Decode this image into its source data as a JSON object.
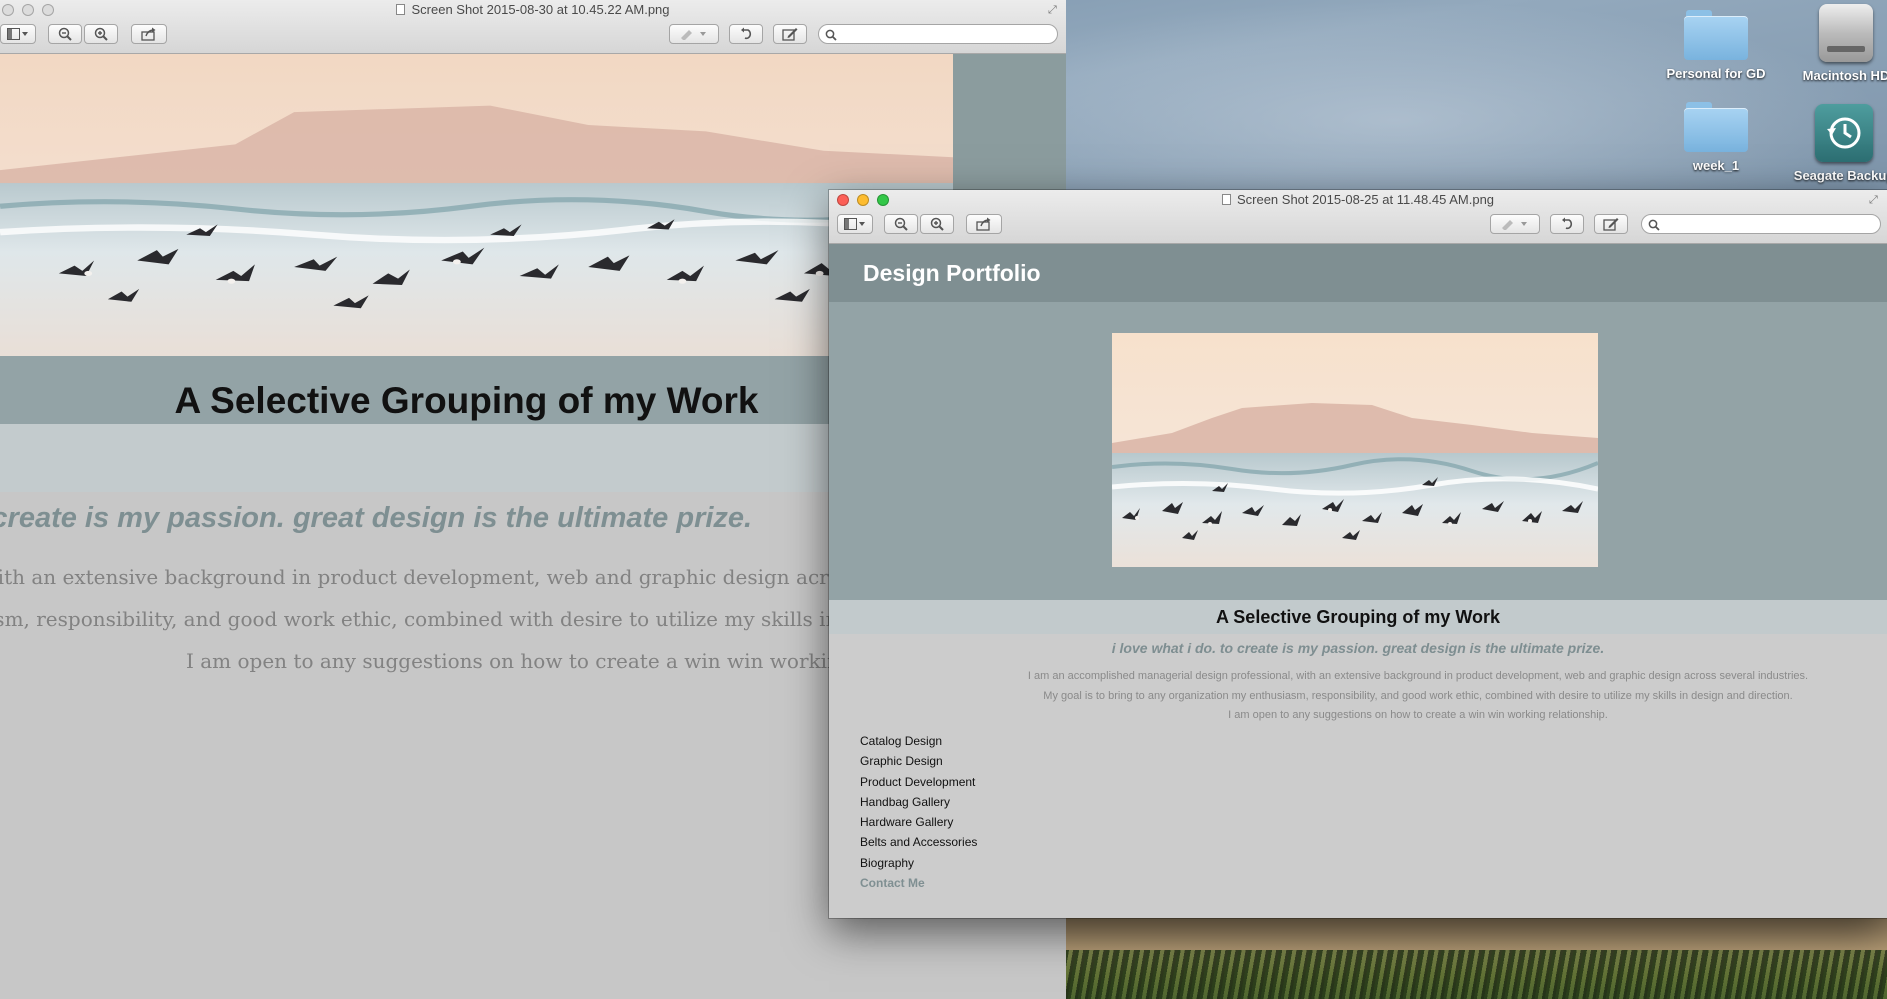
{
  "desktop": {
    "icons": [
      {
        "label": "Personal for GD"
      },
      {
        "label": "Macintosh HD"
      },
      {
        "label": "week_1"
      },
      {
        "label": "Seagate Backup"
      }
    ]
  },
  "back_window": {
    "title": "Screen Shot 2015-08-30 at 10.45.22 AM.png",
    "page": {
      "heading": "A Selective Grouping of my Work",
      "tagline": "i love what i do. to create is my passion. great design is the ultimate prize.",
      "paragraph_lines": [
        "I am an accomplished managerial design professional, with an extensive background in product development, web and graphic design across several industries.",
        "My goal is to bring to any organization my enthusiasm, responsibility, and good work ethic, combined with desire to utilize my skills in design and direction.",
        "I am open to any suggestions on how to create a win win working relationship."
      ]
    }
  },
  "front_window": {
    "title": "Screen Shot 2015-08-25 at 11.48.45 AM.png",
    "page": {
      "brand": "Design Portfolio",
      "heading": "A Selective Grouping of my Work",
      "tagline": "i love what i do. to create is my passion. great design is the ultimate prize.",
      "paragraph_lines": [
        "I am an accomplished managerial design professional, with an extensive background in product development, web and graphic design across several industries.",
        "My goal is to bring to any organization my enthusiasm, responsibility, and good work ethic, combined with desire to utilize my skills in design and direction.",
        "I am open to any suggestions on how to create a win win working relationship."
      ],
      "nav": [
        "Catalog Design",
        "Graphic Design",
        "Product Development",
        "Handbag Gallery",
        "Hardware Gallery",
        "Belts and Accessories",
        "Biography",
        "Contact Me"
      ]
    }
  },
  "icons": {
    "sidebar_toggle": "sidebar-icon",
    "zoom_out": "zoom-out-icon",
    "zoom_in": "zoom-in-icon",
    "share": "share-icon",
    "annotate": "pen-icon",
    "rotate": "rotate-icon",
    "edit": "edit-toolbox-icon",
    "search": "search-icon"
  },
  "colors": {
    "header": "#7f8f92",
    "hero_band": "#93a3a6",
    "heading_band": "#c2cacc",
    "tagline": "#7e8e91",
    "body": "#cccccc"
  }
}
